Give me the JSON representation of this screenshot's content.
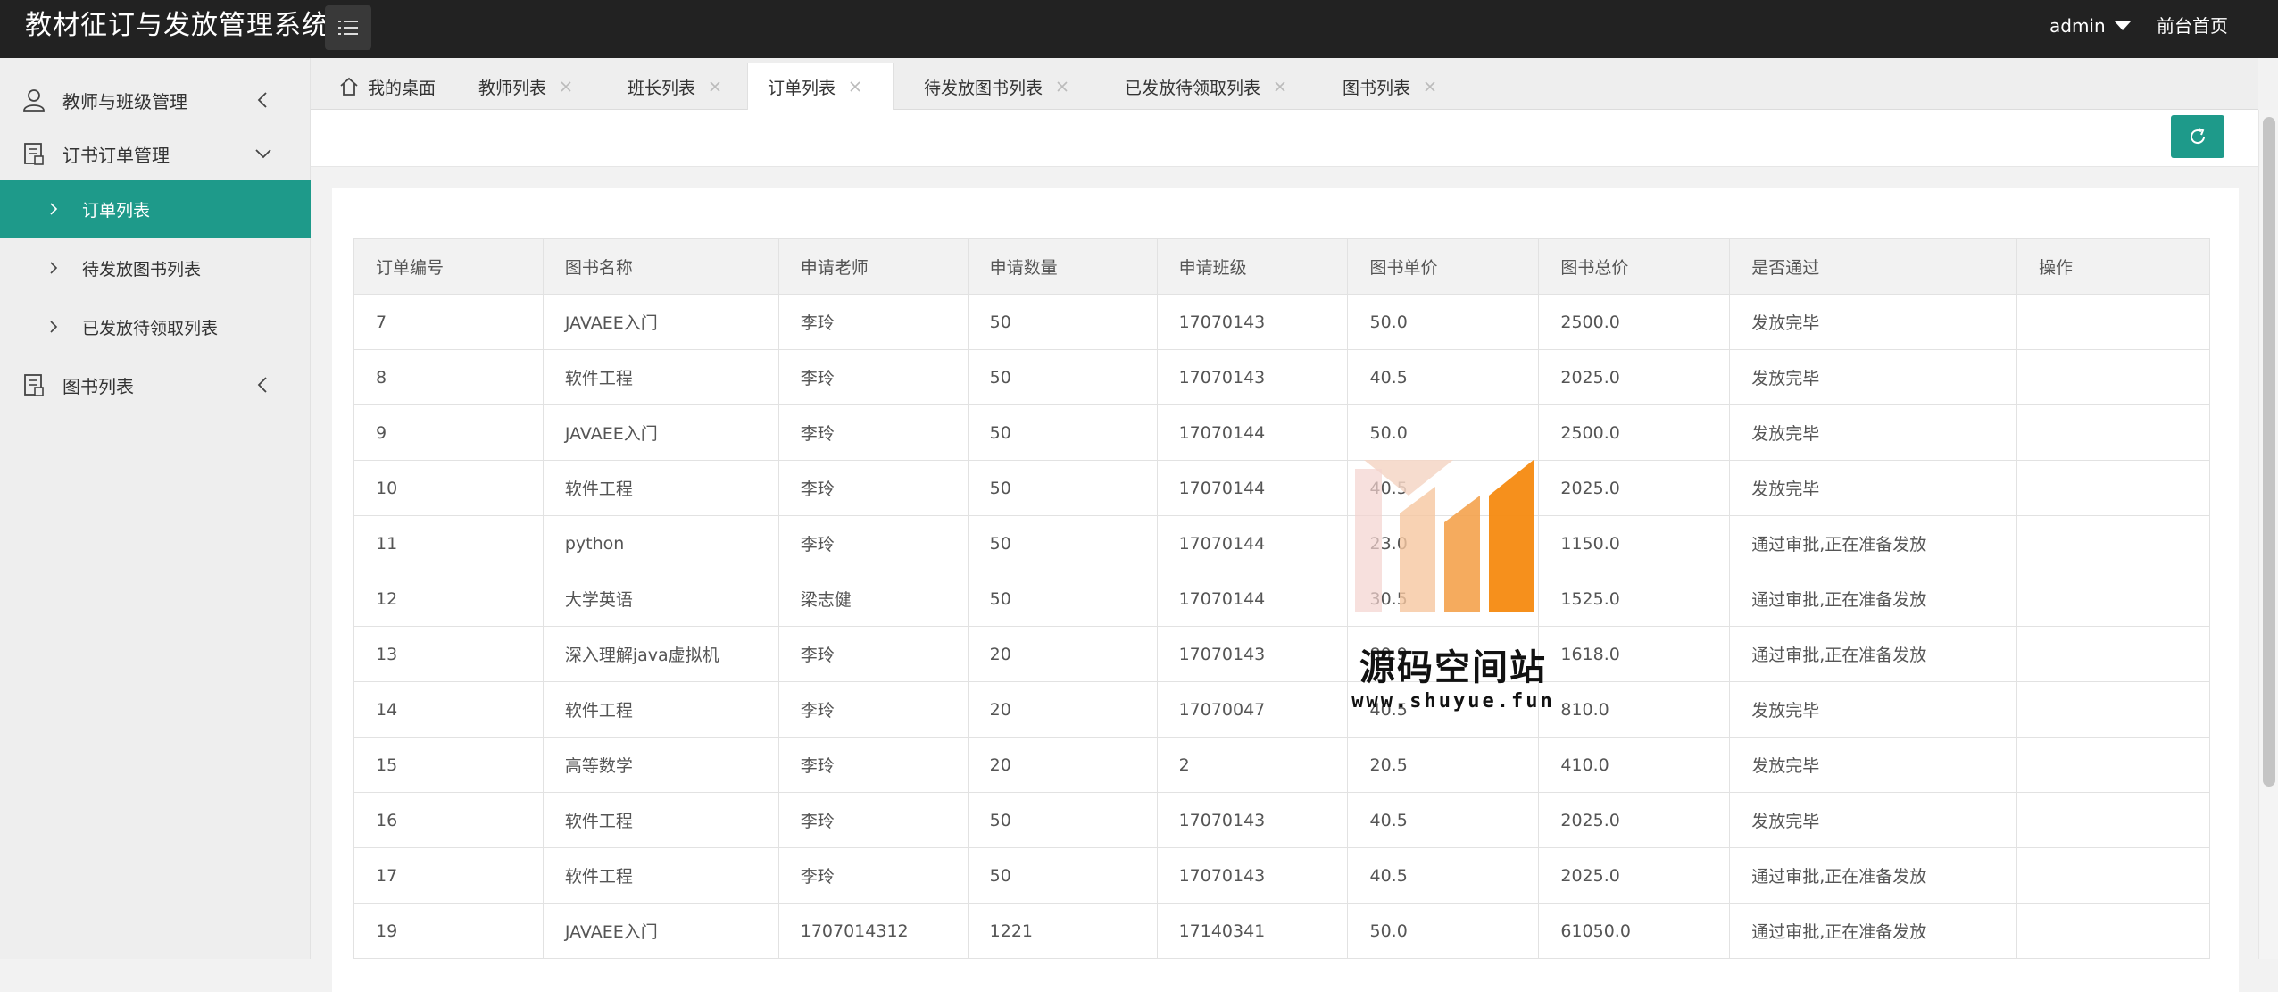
{
  "header": {
    "title": "教材征订与发放管理系统",
    "user": "admin",
    "front_link": "前台首页"
  },
  "sidebar": {
    "groups": [
      {
        "label": "教师与班级管理",
        "icon": "user-icon"
      },
      {
        "label": "订书订单管理",
        "icon": "document-icon"
      },
      {
        "label": "图书列表",
        "icon": "document-icon"
      }
    ],
    "subitems": [
      {
        "label": "订单列表",
        "active": true
      },
      {
        "label": "待发放图书列表",
        "active": false
      },
      {
        "label": "已发放待领取列表",
        "active": false
      }
    ]
  },
  "tabs": [
    {
      "label": "我的桌面",
      "icon": "home-icon"
    },
    {
      "label": "教师列表"
    },
    {
      "label": "班长列表"
    },
    {
      "label": "订单列表",
      "active": true
    },
    {
      "label": "待发放图书列表"
    },
    {
      "label": "已发放待领取列表"
    },
    {
      "label": "图书列表"
    }
  ],
  "table": {
    "headers": [
      "订单编号",
      "图书名称",
      "申请老师",
      "申请数量",
      "申请班级",
      "图书单价",
      "图书总价",
      "是否通过",
      "操作"
    ],
    "rows": [
      [
        "7",
        "JAVAEE入门",
        "李玲",
        "50",
        "17070143",
        "50.0",
        "2500.0",
        "发放完毕",
        ""
      ],
      [
        "8",
        "软件工程",
        "李玲",
        "50",
        "17070143",
        "40.5",
        "2025.0",
        "发放完毕",
        ""
      ],
      [
        "9",
        "JAVAEE入门",
        "李玲",
        "50",
        "17070144",
        "50.0",
        "2500.0",
        "发放完毕",
        ""
      ],
      [
        "10",
        "软件工程",
        "李玲",
        "50",
        "17070144",
        "40.5",
        "2025.0",
        "发放完毕",
        ""
      ],
      [
        "11",
        "python",
        "李玲",
        "50",
        "17070144",
        "23.0",
        "1150.0",
        "通过审批,正在准备发放",
        ""
      ],
      [
        "12",
        "大学英语",
        "梁志健",
        "50",
        "17070144",
        "30.5",
        "1525.0",
        "通过审批,正在准备发放",
        ""
      ],
      [
        "13",
        "深入理解java虚拟机",
        "李玲",
        "20",
        "17070143",
        "80.9",
        "1618.0",
        "通过审批,正在准备发放",
        ""
      ],
      [
        "14",
        "软件工程",
        "李玲",
        "20",
        "17070047",
        "40.5",
        "810.0",
        "发放完毕",
        ""
      ],
      [
        "15",
        "高等数学",
        "李玲",
        "20",
        "2",
        "20.5",
        "410.0",
        "发放完毕",
        ""
      ],
      [
        "16",
        "软件工程",
        "李玲",
        "50",
        "17070143",
        "40.5",
        "2025.0",
        "发放完毕",
        ""
      ],
      [
        "17",
        "软件工程",
        "李玲",
        "50",
        "17070143",
        "40.5",
        "2025.0",
        "通过审批,正在准备发放",
        ""
      ],
      [
        "19",
        "JAVAEE入门",
        "1707014312",
        "1221",
        "17140341",
        "50.0",
        "61050.0",
        "通过审批,正在准备发放",
        ""
      ]
    ]
  },
  "watermark": {
    "text": "源码空间站",
    "url": "www.shuyue.fun"
  },
  "colors": {
    "header_bg": "#222222",
    "accent": "#1e9a8a"
  }
}
